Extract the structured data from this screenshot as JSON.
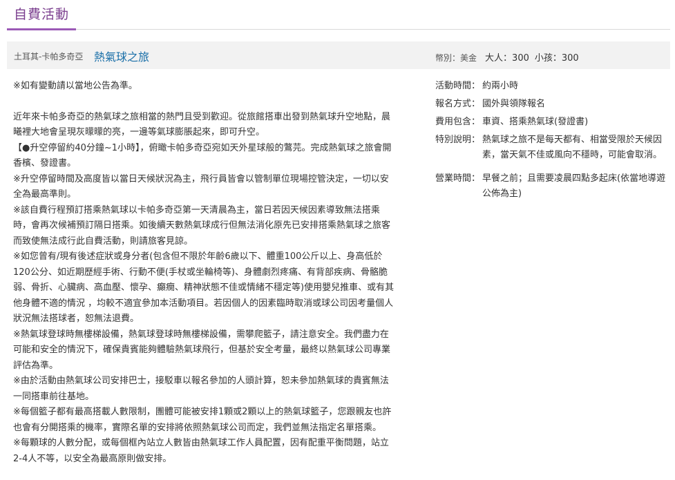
{
  "section": {
    "title": "自費活動"
  },
  "tour": {
    "location": "土耳其-卡帕多奇亞",
    "name": "熱氣球之旅",
    "currency_label": "幣別：",
    "currency": "美金",
    "adult_label": "大人：",
    "adult_price": "300",
    "child_label": "小孩：",
    "child_price": "300"
  },
  "description": {
    "notice": "※如有變動請以當地公告為準。",
    "paragraphs": [
      "近年來卡帕多奇亞的熱氣球之旅相當的熱門且受到歡迎。從旅館搭車出發到熱氣球升空地點，晨曦裡大地會呈現灰曚曚的亮，一邊等氣球膨脹起來，即可升空。",
      "【●升空停留約40分鐘~1小時】，俯瞰卡帕多奇亞宛如天外星球般的鷩芫。完成熱氣球之旅會開香檳、發證書。",
      "※升空停留時間及高度皆以當日天候狀況為主，飛行員皆會以管制單位現場控管決定，一切以安全為最高準則。",
      "※該自費行程預訂搭乘熱氣球以卡帕多奇亞第一天清晨為主，當日若因天候因素導致無法搭乘時，會再次候補預訂隔日搭乘。如後續天數熱氣球成行但無法消化原先已安排搭乘熱氣球之旅客而致使無法成行此自費活動，則請旅客見諒。",
      "※如您曾有/現有後述症狀或身分者(包含但不限於年齡6歲以下、體重100公斤以上、身高低於120公分、如近期歷經手術、行動不便(手杖或坐輪椅等)、身體劇烈疼痛、有背部疾病、骨骼脆弱、骨折、心臟病、高血壓、懷孕、癲癇、精神狀態不佳或情緒不穩定等)使用嬰兒推車、或有其他身體不適的情況 ，均較不適宜參加本活動項目。若因個人的因素臨時取消或球公司因考量個人狀況無法搭球者，恕無法退費。",
      "※熱氣球登球時無樓梯設備，熱氣球登球時無樓梯設備，需攀爬籃子，請注意安全。我們盡力在可能和安全的情況下，確保貴賓能夠體驗熱氣球飛行，但基於安全考量，最終以熱氣球公司專業評估為準。",
      "※由於活動由熱氣球公司安排巴士，接駁車以報名參加的人頭計算，恕未參加熱氣球的貴賓無法一同搭車前往基地。",
      "※每個籃子都有最高搭載人數限制，團體可能被安排1顆或2顆以上的熱氣球籃子，您跟親友也許也會有分開搭乘的機率，實際名單的安排將依照熱氣球公司而定，我們並無法指定名單搭乘。",
      "※每顆球的人數分配，或每個框內站立人數皆由熱氣球工作人員配置，因有配重平衡問題，站立2-4人不等，以安全為最高原則做安排。"
    ]
  },
  "details": [
    {
      "label": "活動時間：",
      "value": "約兩小時"
    },
    {
      "label": "報名方式：",
      "value": "國外與領隊報名"
    },
    {
      "label": "費用包含：",
      "value": "車資、搭乘熱氣球(發證書)"
    },
    {
      "label": "特別說明：",
      "value": "熱氣球之旅不是每天都有、相當受限於天候因素，當天氣不佳或風向不穩時，可能會取消。"
    },
    {
      "label": "營業時間：",
      "value": "早餐之前；且需要凌晨四點多起床(依當地導遊公佈為主)"
    }
  ]
}
